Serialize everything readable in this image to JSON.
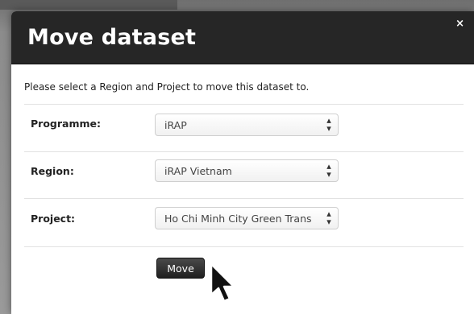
{
  "modal": {
    "title": "Move dataset",
    "close_glyph": "×",
    "instruction": "Please select a Region and Project to move this dataset to."
  },
  "fields": {
    "programme": {
      "label": "Programme:",
      "value": "iRAP"
    },
    "region": {
      "label": "Region:",
      "value": "iRAP Vietnam"
    },
    "project": {
      "label": "Project:",
      "value": "Ho Chi Minh City Green Trans"
    }
  },
  "select_arrow": "⬍",
  "actions": {
    "move_label": "Move"
  },
  "colors": {
    "header_bg": "#262626",
    "button_bg": "#2b2b2b",
    "backdrop": "#8a8a8a"
  },
  "icons": {
    "cursor": "mouse-pointer-icon",
    "close": "close-icon",
    "select_arrows": "updown-arrows-icon"
  }
}
